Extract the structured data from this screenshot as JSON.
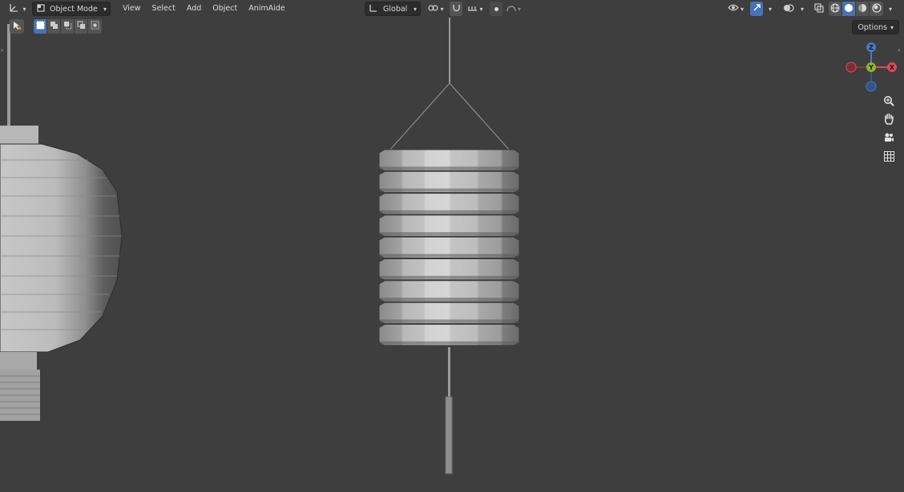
{
  "header": {
    "editor_type_icon": "axes-icon",
    "mode_icon": "cube-icon",
    "mode_label": "Object Mode",
    "menus": [
      "View",
      "Select",
      "Add",
      "Object",
      "AnimAide"
    ],
    "transform_orientation": "Global",
    "options_label": "Options"
  },
  "colors": {
    "background": "#3e3e3e",
    "header": "#303030",
    "accent": "#4772b3",
    "axis_x": "#e04a55",
    "axis_y": "#8ab82f",
    "axis_z": "#4679c4"
  },
  "gizmo": {
    "z_label": "Z",
    "y_label": "Y",
    "x_label": "X"
  },
  "nav_tools": [
    "zoom-icon",
    "hand-pan-icon",
    "camera-view-icon",
    "grid-ortho-icon"
  ]
}
